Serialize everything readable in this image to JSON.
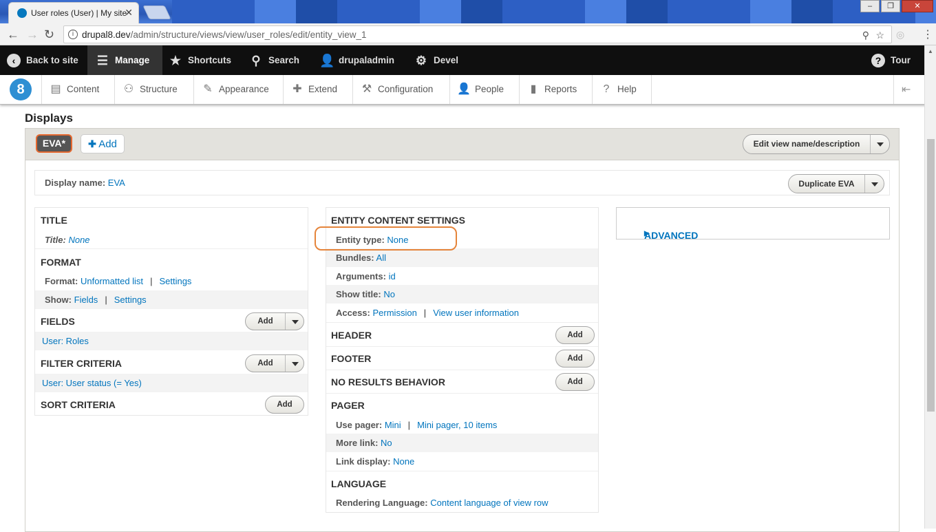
{
  "browser": {
    "tab_title": "User roles (User) | My site",
    "tab_close": "✕",
    "url_host": "drupal8.dev",
    "url_path": "/admin/structure/views/view/user_roles/edit/entity_view_1",
    "window_buttons": [
      "–",
      "❐",
      "✕"
    ]
  },
  "toolbar": {
    "back": "Back to site",
    "manage": "Manage",
    "shortcuts": "Shortcuts",
    "search": "Search",
    "user": "drupaladmin",
    "devel": "Devel",
    "tour": "Tour"
  },
  "tray": [
    "Content",
    "Structure",
    "Appearance",
    "Extend",
    "Configuration",
    "People",
    "Reports",
    "Help"
  ],
  "page": {
    "displays_heading": "Displays",
    "display_tab": "EVA*",
    "add_label": "Add",
    "edit_view_btn": "Edit view name/description",
    "display_name_label": "Display name:",
    "display_name_value": "EVA",
    "duplicate_btn": "Duplicate EVA",
    "advanced": "ADVANCED"
  },
  "left": {
    "title_h": "TITLE",
    "title_label": "Title:",
    "title_value": "None",
    "format_h": "FORMAT",
    "format_label": "Format:",
    "format_value": "Unformatted list",
    "format_settings": "Settings",
    "show_label": "Show:",
    "show_value": "Fields",
    "show_settings": "Settings",
    "fields_h": "FIELDS",
    "fields_item": "User: Roles",
    "filter_h": "FILTER CRITERIA",
    "filter_item": "User: User status (= Yes)",
    "sort_h": "SORT CRITERIA",
    "add_btn": "Add",
    "sep": "|"
  },
  "middle": {
    "ecs_h": "ENTITY CONTENT SETTINGS",
    "entity_type_label": "Entity type:",
    "entity_type_value": "None",
    "bundles_label": "Bundles:",
    "bundles_value": "All",
    "arguments_label": "Arguments:",
    "arguments_value": "id",
    "show_title_label": "Show title:",
    "show_title_value": "No",
    "access_label": "Access:",
    "access_value": "Permission",
    "access_detail": "View user information",
    "header_h": "HEADER",
    "footer_h": "FOOTER",
    "no_results_h": "NO RESULTS BEHAVIOR",
    "pager_h": "PAGER",
    "use_pager_label": "Use pager:",
    "use_pager_value": "Mini",
    "use_pager_detail": "Mini pager, 10 items",
    "more_link_label": "More link:",
    "more_link_value": "No",
    "link_display_label": "Link display:",
    "link_display_value": "None",
    "language_h": "LANGUAGE",
    "rendering_label": "Rendering Language:",
    "rendering_value": "Content language of view row",
    "add_btn": "Add",
    "sep": "|"
  }
}
